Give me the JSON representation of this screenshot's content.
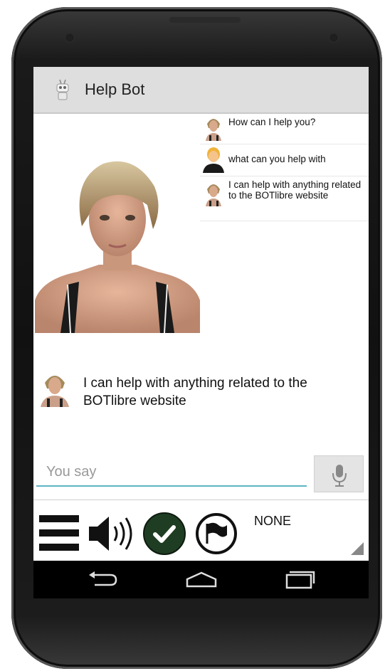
{
  "app": {
    "title": "Help Bot"
  },
  "chat": {
    "messages": [
      {
        "from": "bot",
        "text": "How can I help you?"
      },
      {
        "from": "user",
        "text": "what can you help with"
      },
      {
        "from": "bot",
        "text": "I can help with anything related to the BOTlibre website"
      }
    ]
  },
  "response": {
    "text": "I can help with anything related to the BOTlibre website"
  },
  "input": {
    "placeholder": "You say"
  },
  "toolbar": {
    "emote_value": "NONE"
  },
  "icons": {
    "app": "robot-icon",
    "mic": "microphone-icon",
    "menu": "menu-icon",
    "sound": "speaker-icon",
    "correct": "check-icon",
    "flag": "flag-icon",
    "back": "back-icon",
    "home": "home-icon",
    "recents": "recents-icon"
  },
  "colors": {
    "input_accent": "#5fb4c4",
    "check_bg": "#1f3d22",
    "action_bar": "#dedede"
  }
}
